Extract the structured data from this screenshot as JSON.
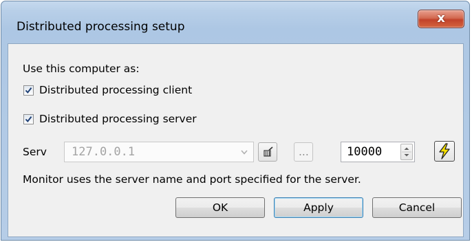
{
  "window": {
    "title": "Distributed processing setup",
    "close_glyph": "x"
  },
  "form": {
    "use_as_label": "Use this computer as:",
    "client_checkbox": {
      "label": "Distributed processing client",
      "checked": true
    },
    "server_checkbox": {
      "label": "Distributed processing server",
      "checked": true
    },
    "server_label": "Serv",
    "server_address": "127.0.0.1",
    "browse_label": "...",
    "port_value": "10000",
    "info_text": "Monitor uses the server name and port specified for the server."
  },
  "buttons": {
    "ok": "OK",
    "apply": "Apply",
    "cancel": "Cancel"
  },
  "icons": {
    "close": "close-icon",
    "checkmark": "checkmark-icon",
    "dropdown": "chevron-down-icon",
    "clear": "broom-icon",
    "spin": "spin-arrows-icon",
    "connect": "lightning-icon"
  },
  "colors": {
    "title_bar": "#b8cfe8",
    "close_button": "#c7442a",
    "dialog_bg": "#f0f0f0",
    "lightning": "#f6e000"
  }
}
